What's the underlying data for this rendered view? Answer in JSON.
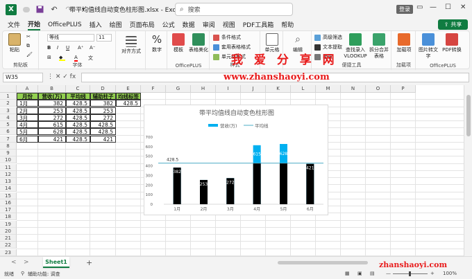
{
  "titlebar": {
    "app_logo": "X",
    "title": "带平均值线自动变色柱形图.xlsx  -  Excel",
    "search_placeholder": "搜索",
    "login": "登录",
    "minimize": "—",
    "restore": "☐",
    "close": "✕"
  },
  "tabs": [
    "文件",
    "开始",
    "OfficePLUS",
    "插入",
    "绘图",
    "页面布局",
    "公式",
    "数据",
    "审阅",
    "视图",
    "PDF工具箱",
    "帮助"
  ],
  "share": "共享",
  "ribbon": {
    "clipboard": {
      "paste": "粘贴",
      "label": "剪贴板"
    },
    "font": {
      "name": "等线",
      "size": "11",
      "bold": "B",
      "italic": "I",
      "underline": "U",
      "font_color_letter": "A",
      "label": "字体"
    },
    "alignment": {
      "btn": "对齐方式"
    },
    "number": {
      "btn": "数字"
    },
    "officeplus": {
      "templates": "模板",
      "beautify": "表格美化",
      "label": "OfficePLUS"
    },
    "styles": {
      "conditional": "条件格式",
      "table_format": "套用表格格式",
      "cell_style": "单元格样式",
      "label": "样式"
    },
    "cells": {
      "btn": "单元格"
    },
    "editing": {
      "btn": "编辑"
    },
    "tools": {
      "advanced_filter": "高级筛选",
      "text_extract": "文本提取",
      "batch": "批量",
      "lookup": "查找录入",
      "vlookup": "VLOOKUP",
      "split_merge": "拆分合并",
      "table": "表格",
      "label": "便捷工具"
    },
    "addins": {
      "btn": "加载项",
      "label": "加载项"
    },
    "officeplus2": {
      "img2text": "图片转文字",
      "pdf2table": "PDF转换",
      "label": "OfficePLUS"
    }
  },
  "watermark": {
    "cn": "我 爱 分 享 网",
    "url": "www.zhanshaoyi.com",
    "url2": "zhanshaoyi.com"
  },
  "formula_bar": {
    "namebox": "W35",
    "icons": "⋮  ✕  ✓  fx",
    "formula": ""
  },
  "columns": [
    "A",
    "B",
    "C",
    "D",
    "E",
    "F",
    "G",
    "H",
    "I",
    "J",
    "K",
    "L",
    "M",
    "N",
    "O",
    "P"
  ],
  "rows": [
    "1",
    "2",
    "3",
    "4",
    "5",
    "6",
    "7",
    "8",
    "9",
    "10",
    "11",
    "12",
    "13",
    "14",
    "15",
    "16",
    "17",
    "18",
    "19",
    "20",
    "21",
    "22",
    "23"
  ],
  "table": {
    "headers": [
      "月份",
      "营收(万)",
      "平均线",
      "辅助柱子",
      "均线标签"
    ],
    "rows": [
      [
        "1月",
        "382",
        "428.5",
        "382",
        "428.5"
      ],
      [
        "2月",
        "253",
        "428.5",
        "253",
        ""
      ],
      [
        "3月",
        "272",
        "428.5",
        "272",
        ""
      ],
      [
        "4月",
        "615",
        "428.5",
        "428.5",
        ""
      ],
      [
        "5月",
        "628",
        "428.5",
        "428.5",
        ""
      ],
      [
        "6月",
        "421",
        "428.5",
        "421",
        ""
      ]
    ]
  },
  "chart_data": {
    "type": "bar",
    "title": "带平均值线自动变色柱形图",
    "categories": [
      "1月",
      "2月",
      "3月",
      "4月",
      "5月",
      "6月"
    ],
    "series": [
      {
        "name": "营收(万)",
        "values": [
          382,
          253,
          272,
          615,
          628,
          421
        ],
        "color": "#00b0f0"
      },
      {
        "name": "辅助柱子",
        "values": [
          382,
          253,
          272,
          428.5,
          428.5,
          421
        ],
        "color": "#000000"
      },
      {
        "name": "平均线",
        "values": [
          428.5,
          428.5,
          428.5,
          428.5,
          428.5,
          428.5
        ],
        "color": "#4bacc6"
      }
    ],
    "average_label": "428.5",
    "ylim": [
      0,
      700
    ],
    "yticks": [
      0,
      100,
      200,
      300,
      400,
      500,
      600,
      700
    ],
    "grid": false,
    "legend": "top"
  },
  "sheets": {
    "nav_prev": "<",
    "nav_next": ">",
    "active": "Sheet1",
    "add": "+"
  },
  "status": {
    "ready": "就绪",
    "accessibility": "辅助功能: 调查",
    "zoom": "100%",
    "zoom_minus": "—",
    "zoom_plus": "+"
  }
}
